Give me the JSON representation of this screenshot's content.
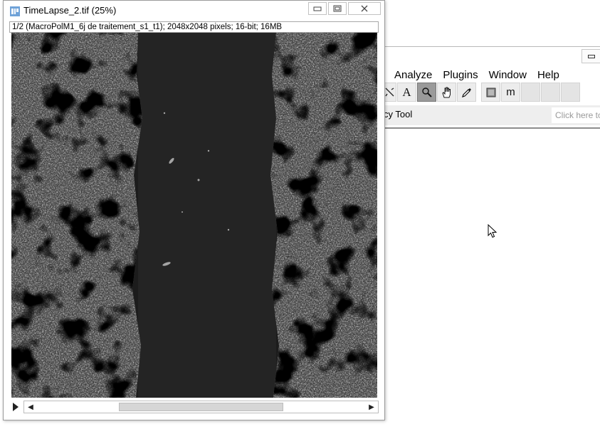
{
  "image_window": {
    "title": "TimeLapse_2.tif (25%)",
    "info": "1/2 (MacroPolM1_6j de traitement_s1_t1); 2048x2048 pixels; 16-bit; 16MB",
    "icons": {
      "app": "imagej-stack-icon",
      "minimize": "minimize-icon",
      "maximize": "maximize-icon",
      "close": "close-icon",
      "play": "play-animation-icon",
      "scroll_left": "arrow-left-icon",
      "scroll_right": "arrow-right-icon"
    },
    "slice_scroll": {
      "position_fraction": 0.5
    }
  },
  "main_window": {
    "menu": [
      "Analyze",
      "Plugins",
      "Window",
      "Help"
    ],
    "tools": [
      {
        "icon": "line-tool-icon",
        "label": ""
      },
      {
        "icon": "text-tool-icon",
        "label": "A"
      },
      {
        "icon": "magnifier-icon",
        "label": ""
      },
      {
        "icon": "hand-scroll-icon",
        "label": ""
      },
      {
        "icon": "color-picker-icon",
        "label": ""
      },
      {
        "icon": "stack-tool-icon",
        "label": ""
      },
      {
        "icon": "macro-tool-icon",
        "label": "m"
      }
    ],
    "selected_tool": "magnifier-icon",
    "status": "cy Tool",
    "search_placeholder": "Click here to"
  },
  "colors": {
    "image_bg": "#1a1a1a",
    "pressed_tool": "#9a9a9a",
    "window_border": "#9b9b9b"
  }
}
